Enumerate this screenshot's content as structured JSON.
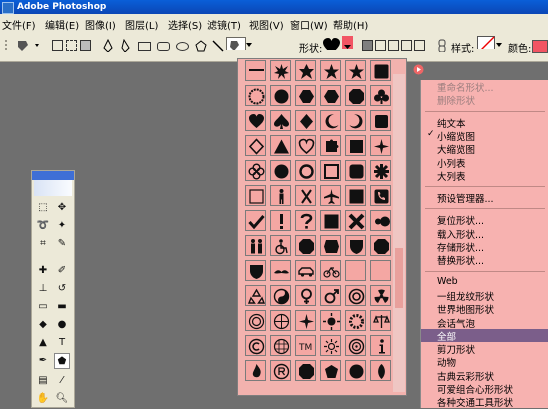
{
  "window": {
    "title": "Adobe Photoshop"
  },
  "menubar": [
    {
      "label": "文件(F)"
    },
    {
      "label": "编辑(E)"
    },
    {
      "label": "图像(I)"
    },
    {
      "label": "图层(L)"
    },
    {
      "label": "选择(S)"
    },
    {
      "label": "滤镜(T)"
    },
    {
      "label": "视图(V)"
    },
    {
      "label": "窗口(W)"
    },
    {
      "label": "帮助(H)"
    }
  ],
  "options_bar": {
    "shape_label": "形状:",
    "style_label": "样式:",
    "color_label": "颜色:",
    "color_value": "#f25563"
  },
  "flyout_menu": {
    "items": [
      {
        "label": "重命名形状...",
        "state": "disabled"
      },
      {
        "label": "删除形状",
        "state": "disabled"
      },
      {
        "label": "sep"
      },
      {
        "label": "纯文本",
        "state": "normal"
      },
      {
        "label": "小缩览图",
        "state": "checked"
      },
      {
        "label": "大缩览图",
        "state": "normal"
      },
      {
        "label": "小列表",
        "state": "normal"
      },
      {
        "label": "大列表",
        "state": "normal"
      },
      {
        "label": "sep"
      },
      {
        "label": "预设管理器...",
        "state": "normal"
      },
      {
        "label": "sep"
      },
      {
        "label": "复位形状...",
        "state": "normal"
      },
      {
        "label": "载入形状...",
        "state": "normal"
      },
      {
        "label": "存储形状...",
        "state": "normal"
      },
      {
        "label": "替换形状...",
        "state": "normal"
      },
      {
        "label": "sep"
      },
      {
        "label": "Web",
        "state": "normal"
      },
      {
        "label": "一组龙纹形状",
        "state": "normal"
      },
      {
        "label": "世界地图形状",
        "state": "normal"
      },
      {
        "label": "会话气泡",
        "state": "normal"
      },
      {
        "label": "全部",
        "state": "selected"
      },
      {
        "label": "剪刀形状",
        "state": "normal"
      },
      {
        "label": "动物",
        "state": "normal"
      },
      {
        "label": "古典云彩形状",
        "state": "normal"
      },
      {
        "label": "可爱组合心形形状",
        "state": "normal"
      },
      {
        "label": "各种交通工具形状",
        "state": "normal"
      }
    ]
  },
  "shape_picker": {
    "rows": [
      [
        "dots-shape",
        "burst-shape",
        "star6-shape",
        "star5-shape",
        "star5-shape",
        "seal-shape"
      ],
      [
        "burst2-shape",
        "starburst-shape",
        "hexagon-shape",
        "hexagon-shape",
        "octagon-shape",
        "club-shape"
      ],
      [
        "heart-shape",
        "spade-shape",
        "diamond-shape",
        "moon-shape",
        "crescent-shape",
        "ribbon-shape"
      ],
      [
        "diamond-outline-shape",
        "triangle-shape",
        "heart-outline-shape",
        "puzzle-shape",
        "square-shape",
        "star-cross-shape"
      ],
      [
        "flower-shape",
        "circle-shape",
        "ring-shape",
        "square-outline-shape",
        "rounded-square-shape",
        "asterisk-shape"
      ],
      [
        "frame-shape",
        "person-shape",
        "scissors-shape",
        "airplane-shape",
        "phone-shape",
        "phone-box-shape"
      ],
      [
        "checkmark-shape",
        "exclamation-shape",
        "question-shape",
        "copyright-shape",
        "x-shape",
        "runner-shape"
      ],
      [
        "couple-shape",
        "wheelchair-shape",
        "stop-shape",
        "badge-shape",
        "shield-shape",
        "octagon2-shape"
      ],
      [
        "shield-outline-shape",
        "mustache-shape",
        "car-shape",
        "bicycle-shape",
        "bus-shape",
        "blank-shape"
      ],
      [
        "recycle-shape",
        "yinyang-shape",
        "female-shape",
        "male-shape",
        "target-shape",
        "radiation-shape"
      ],
      [
        "anchor-shape",
        "world-shape",
        "asterisk2-shape",
        "sun-shape",
        "gear-shape",
        "scale-shape"
      ],
      [
        "copyright2-shape",
        "grid-globe-shape",
        "trademark-shape",
        "sun2-shape",
        "clock-shape",
        "info-shape"
      ],
      [
        "fire-shape",
        "registered-shape",
        "lock-shape",
        "flag-shape",
        "key-shape",
        "leaf-shape"
      ]
    ]
  }
}
